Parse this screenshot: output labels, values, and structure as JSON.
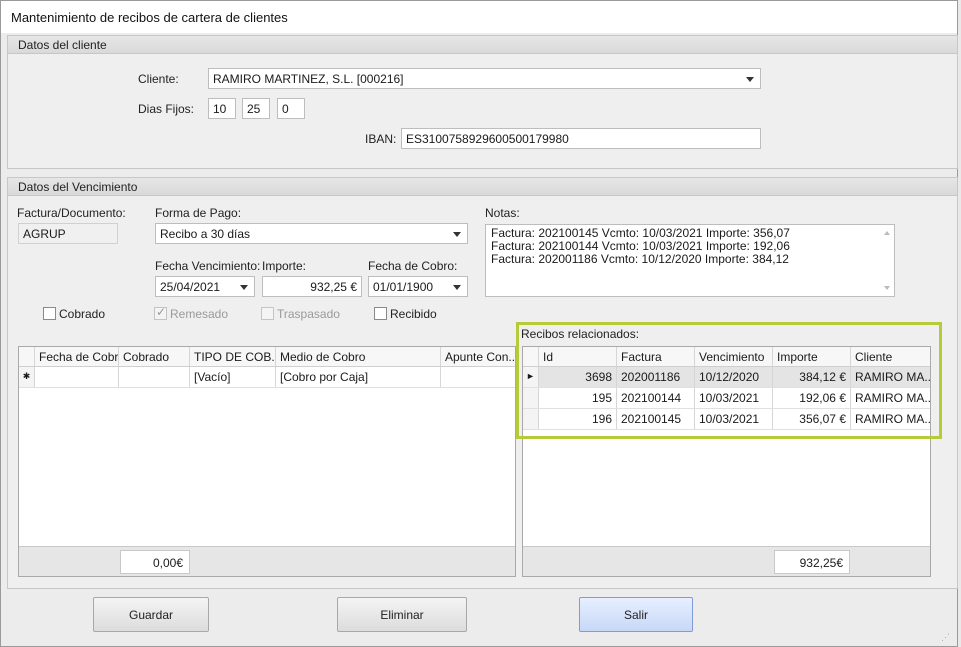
{
  "window": {
    "title": "Mantenimiento de recibos de cartera de clientes"
  },
  "cliente_group": {
    "header": "Datos del cliente",
    "cliente_label": "Cliente:",
    "cliente_value": "RAMIRO MARTINEZ, S.L. [000216]",
    "dias_label": "Dias Fijos:",
    "dias": [
      "10",
      "25",
      "0"
    ],
    "iban_label": "IBAN:",
    "iban_value": "ES3100758929600500179980"
  },
  "vencimiento_group": {
    "header": "Datos del Vencimiento",
    "factura_label": "Factura/Documento:",
    "factura_value": "AGRUP",
    "forma_pago_label": "Forma de Pago:",
    "forma_pago_value": "Recibo a 30 días",
    "fecha_venc_label": "Fecha Vencimiento:",
    "fecha_venc_value": "25/04/2021",
    "importe_label": "Importe:",
    "importe_value": "932,25 €",
    "fecha_cobro_label": "Fecha de Cobro:",
    "fecha_cobro_value": "01/01/1900",
    "notas_label": "Notas:",
    "notas_lines": [
      "Factura: 202100145 Vcmto: 10/03/2021 Importe: 356,07",
      "Factura: 202100144 Vcmto: 10/03/2021 Importe: 192,06",
      "Factura: 202001186 Vcmto: 10/12/2020 Importe: 384,12"
    ],
    "checks": {
      "cobrado": {
        "label": "Cobrado",
        "checked": false,
        "enabled": true
      },
      "remesado": {
        "label": "Remesado",
        "checked": true,
        "enabled": false
      },
      "traspasado": {
        "label": "Traspasado",
        "checked": false,
        "enabled": false
      },
      "recibido": {
        "label": "Recibido",
        "checked": false,
        "enabled": true
      }
    }
  },
  "cobros_grid": {
    "columns": [
      "Fecha de Cobro",
      "Cobrado",
      "TIPO DE COB...",
      "Medio de  Cobro",
      "Apunte Con..."
    ],
    "new_row_marker": "✱",
    "new_row": [
      "",
      "",
      "[Vacío]",
      "[Cobro por Caja]",
      ""
    ],
    "total": "0,00€"
  },
  "recibos": {
    "label": "Recibos relacionados:",
    "columns": [
      "Id",
      "Factura",
      "Vencimiento",
      "Importe",
      "Cliente"
    ],
    "rows": [
      {
        "id": "3698",
        "factura": "202001186",
        "vencimiento": "10/12/2020",
        "importe": "384,12 €",
        "cliente": "RAMIRO MA..."
      },
      {
        "id": "195",
        "factura": "202100144",
        "vencimiento": "10/03/2021",
        "importe": "192,06 €",
        "cliente": "RAMIRO MA..."
      },
      {
        "id": "196",
        "factura": "202100145",
        "vencimiento": "10/03/2021",
        "importe": "356,07 €",
        "cliente": "RAMIRO MA..."
      }
    ],
    "selected_marker": "►",
    "total": "932,25€"
  },
  "buttons": {
    "guardar": "Guardar",
    "eliminar": "Eliminar",
    "salir": "Salir"
  },
  "colors": {
    "highlight": "#b7ca3a",
    "primary_button": "#c7d8f7"
  }
}
